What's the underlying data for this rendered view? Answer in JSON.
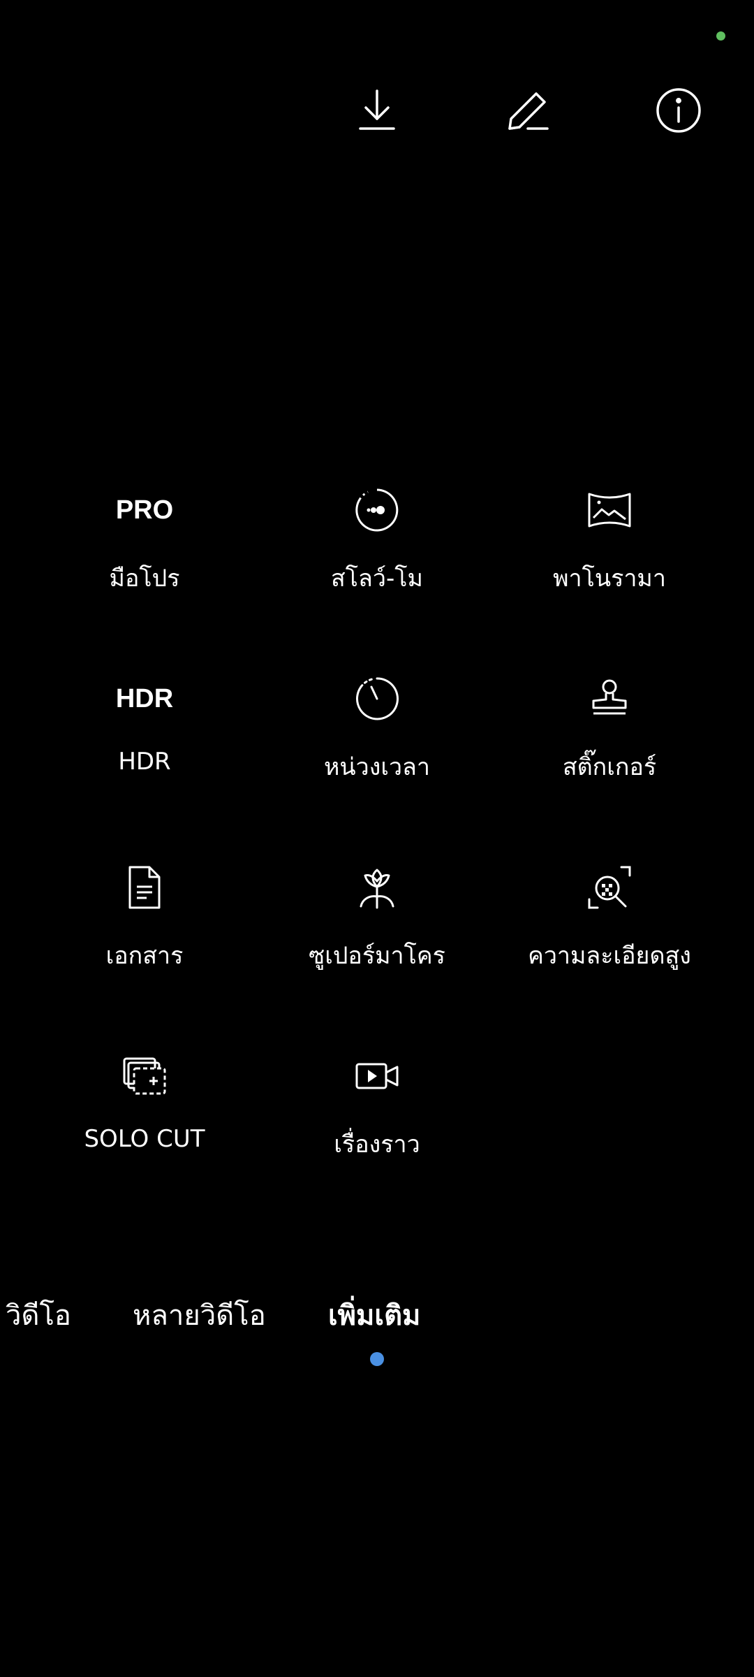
{
  "status": {
    "indicator_color": "#5fbf5f"
  },
  "toolbar": {
    "download_icon": "download-icon",
    "edit_icon": "pencil-icon",
    "info_icon": "info-icon"
  },
  "modes": [
    {
      "icon_text": "PRO",
      "label": "มือโปร"
    },
    {
      "icon": "slow-motion-icon",
      "label": "สโลว์-โม"
    },
    {
      "icon": "panorama-icon",
      "label": "พาโนรามา"
    },
    {
      "icon_text": "HDR",
      "label": "HDR"
    },
    {
      "icon": "timer-icon",
      "label": "หน่วงเวลา"
    },
    {
      "icon": "stamp-icon",
      "label": "สติ๊กเกอร์"
    },
    {
      "icon": "document-icon",
      "label": "เอกสาร"
    },
    {
      "icon": "flower-macro-icon",
      "label": "ซูเปอร์มาโคร"
    },
    {
      "icon": "hi-res-scan-icon",
      "label": "ความละเอียดสูง"
    },
    {
      "icon": "solo-cut-icon",
      "label": "SOLO CUT"
    },
    {
      "icon": "story-video-icon",
      "label": "เรื่องราว"
    }
  ],
  "tabs": [
    {
      "label": "วิดีโอ"
    },
    {
      "label": "หลายวิดีโอ"
    },
    {
      "label": "เพิ่มเติม",
      "active": true
    }
  ],
  "colors": {
    "background": "#000000",
    "foreground": "#ffffff",
    "accent": "#4a90e2"
  }
}
